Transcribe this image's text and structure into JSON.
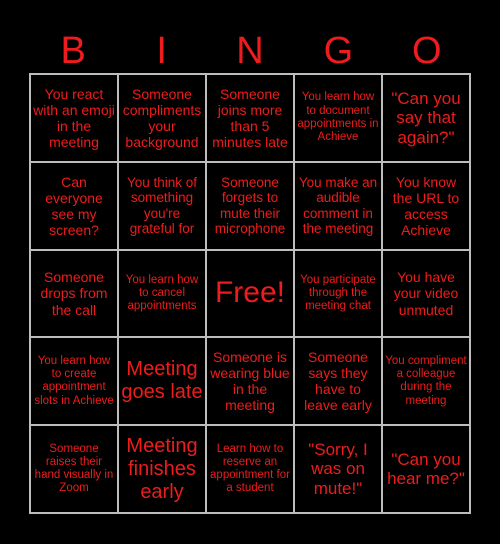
{
  "header": [
    "B",
    "I",
    "N",
    "G",
    "O"
  ],
  "colors": {
    "text": "#ee1c1c",
    "background": "#000000",
    "grid": "#bdbdbd"
  },
  "cells": [
    "You react with an emoji in the meeting",
    "Someone compliments your background",
    "Someone joins more than 5 minutes late",
    "You learn how to document appointments in Achieve",
    "\"Can you say that again?\"",
    "Can everyone see my screen?",
    "You think of something you're grateful for",
    "Someone forgets to mute their microphone",
    "You make an audible comment in the meeting",
    "You know the URL to access Achieve",
    "Someone drops from the call",
    "You learn how to cancel appointments",
    "Free!",
    "You participate through the meeting chat",
    "You have your video unmuted",
    "You learn how to create appointment slots in Achieve",
    "Meeting goes late",
    "Someone is wearing blue in the meeting",
    "Someone says they have to leave early",
    "You compliment a colleague during the meeting",
    "Someone raises their hand visually in Zoom",
    "Meeting finishes early",
    "Learn how to reserve an appointment for a student",
    "\"Sorry, I was on mute!\"",
    "\"Can you hear me?\""
  ]
}
